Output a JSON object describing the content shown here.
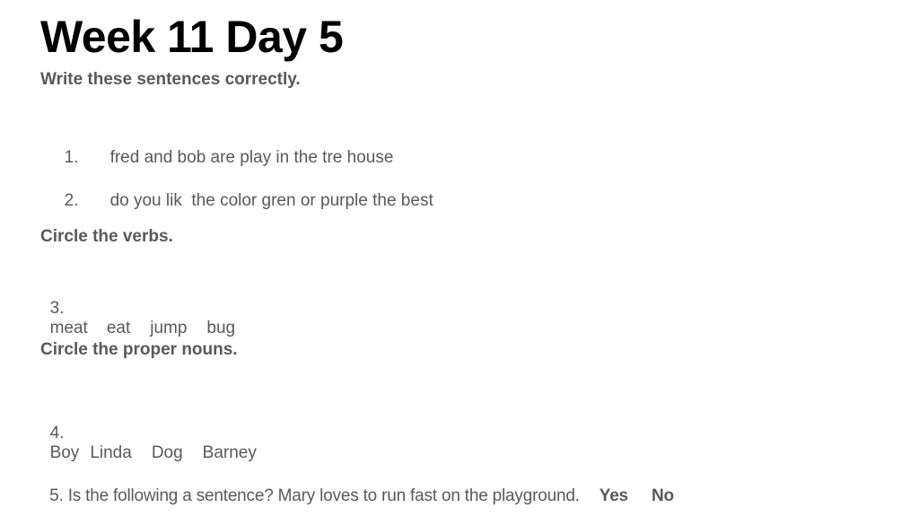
{
  "title": "Week 11 Day 5",
  "instructions": {
    "write_correctly": "Write these sentences correctly.",
    "circle_verbs": "Circle the verbs.",
    "circle_proper_nouns": "Circle the proper nouns."
  },
  "sentences": [
    {
      "number": "1.",
      "text": "fred and bob are play in the tre house"
    },
    {
      "number": "2.",
      "text": "do you lik  the color gren or purple the best"
    }
  ],
  "question3": {
    "number": "3.",
    "words": [
      "meat",
      "eat",
      "jump",
      "bug"
    ]
  },
  "question4": {
    "number": "4.",
    "words": [
      "Boy",
      "Linda",
      "Dog",
      "Barney"
    ]
  },
  "question5": {
    "text": "5. Is the following a sentence? Mary loves to run fast on the playground.",
    "options": [
      "Yes",
      "No"
    ]
  }
}
